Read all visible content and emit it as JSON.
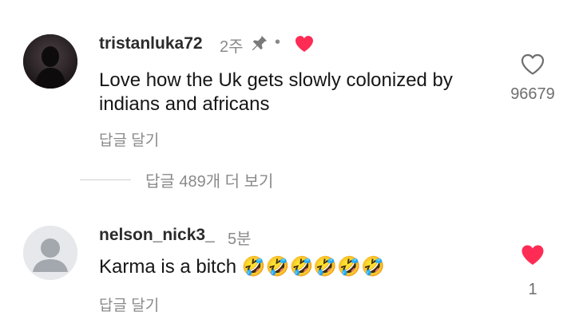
{
  "comments": [
    {
      "username": "tristanluka72",
      "time": "2주",
      "pinned": true,
      "separator": "•",
      "author_liked": true,
      "text": "Love how the Uk gets slowly colonized by indians and africans",
      "reply_label": "답글 달기",
      "like_count": "96679",
      "liked": false
    },
    {
      "username": "nelson_nick3_",
      "time": "5분",
      "text": "Karma is a bitch 🤣🤣🤣🤣🤣🤣",
      "reply_label": "답글 달기",
      "like_count": "1",
      "liked": true
    }
  ],
  "view_replies": "답글 489개 더 보기",
  "colors": {
    "like_red": "#fe2c55",
    "muted": "#8a8a8a",
    "text": "#161616"
  },
  "icons": [
    "pin-icon",
    "heart-filled-icon",
    "heart-outline-icon",
    "default-avatar-icon"
  ]
}
